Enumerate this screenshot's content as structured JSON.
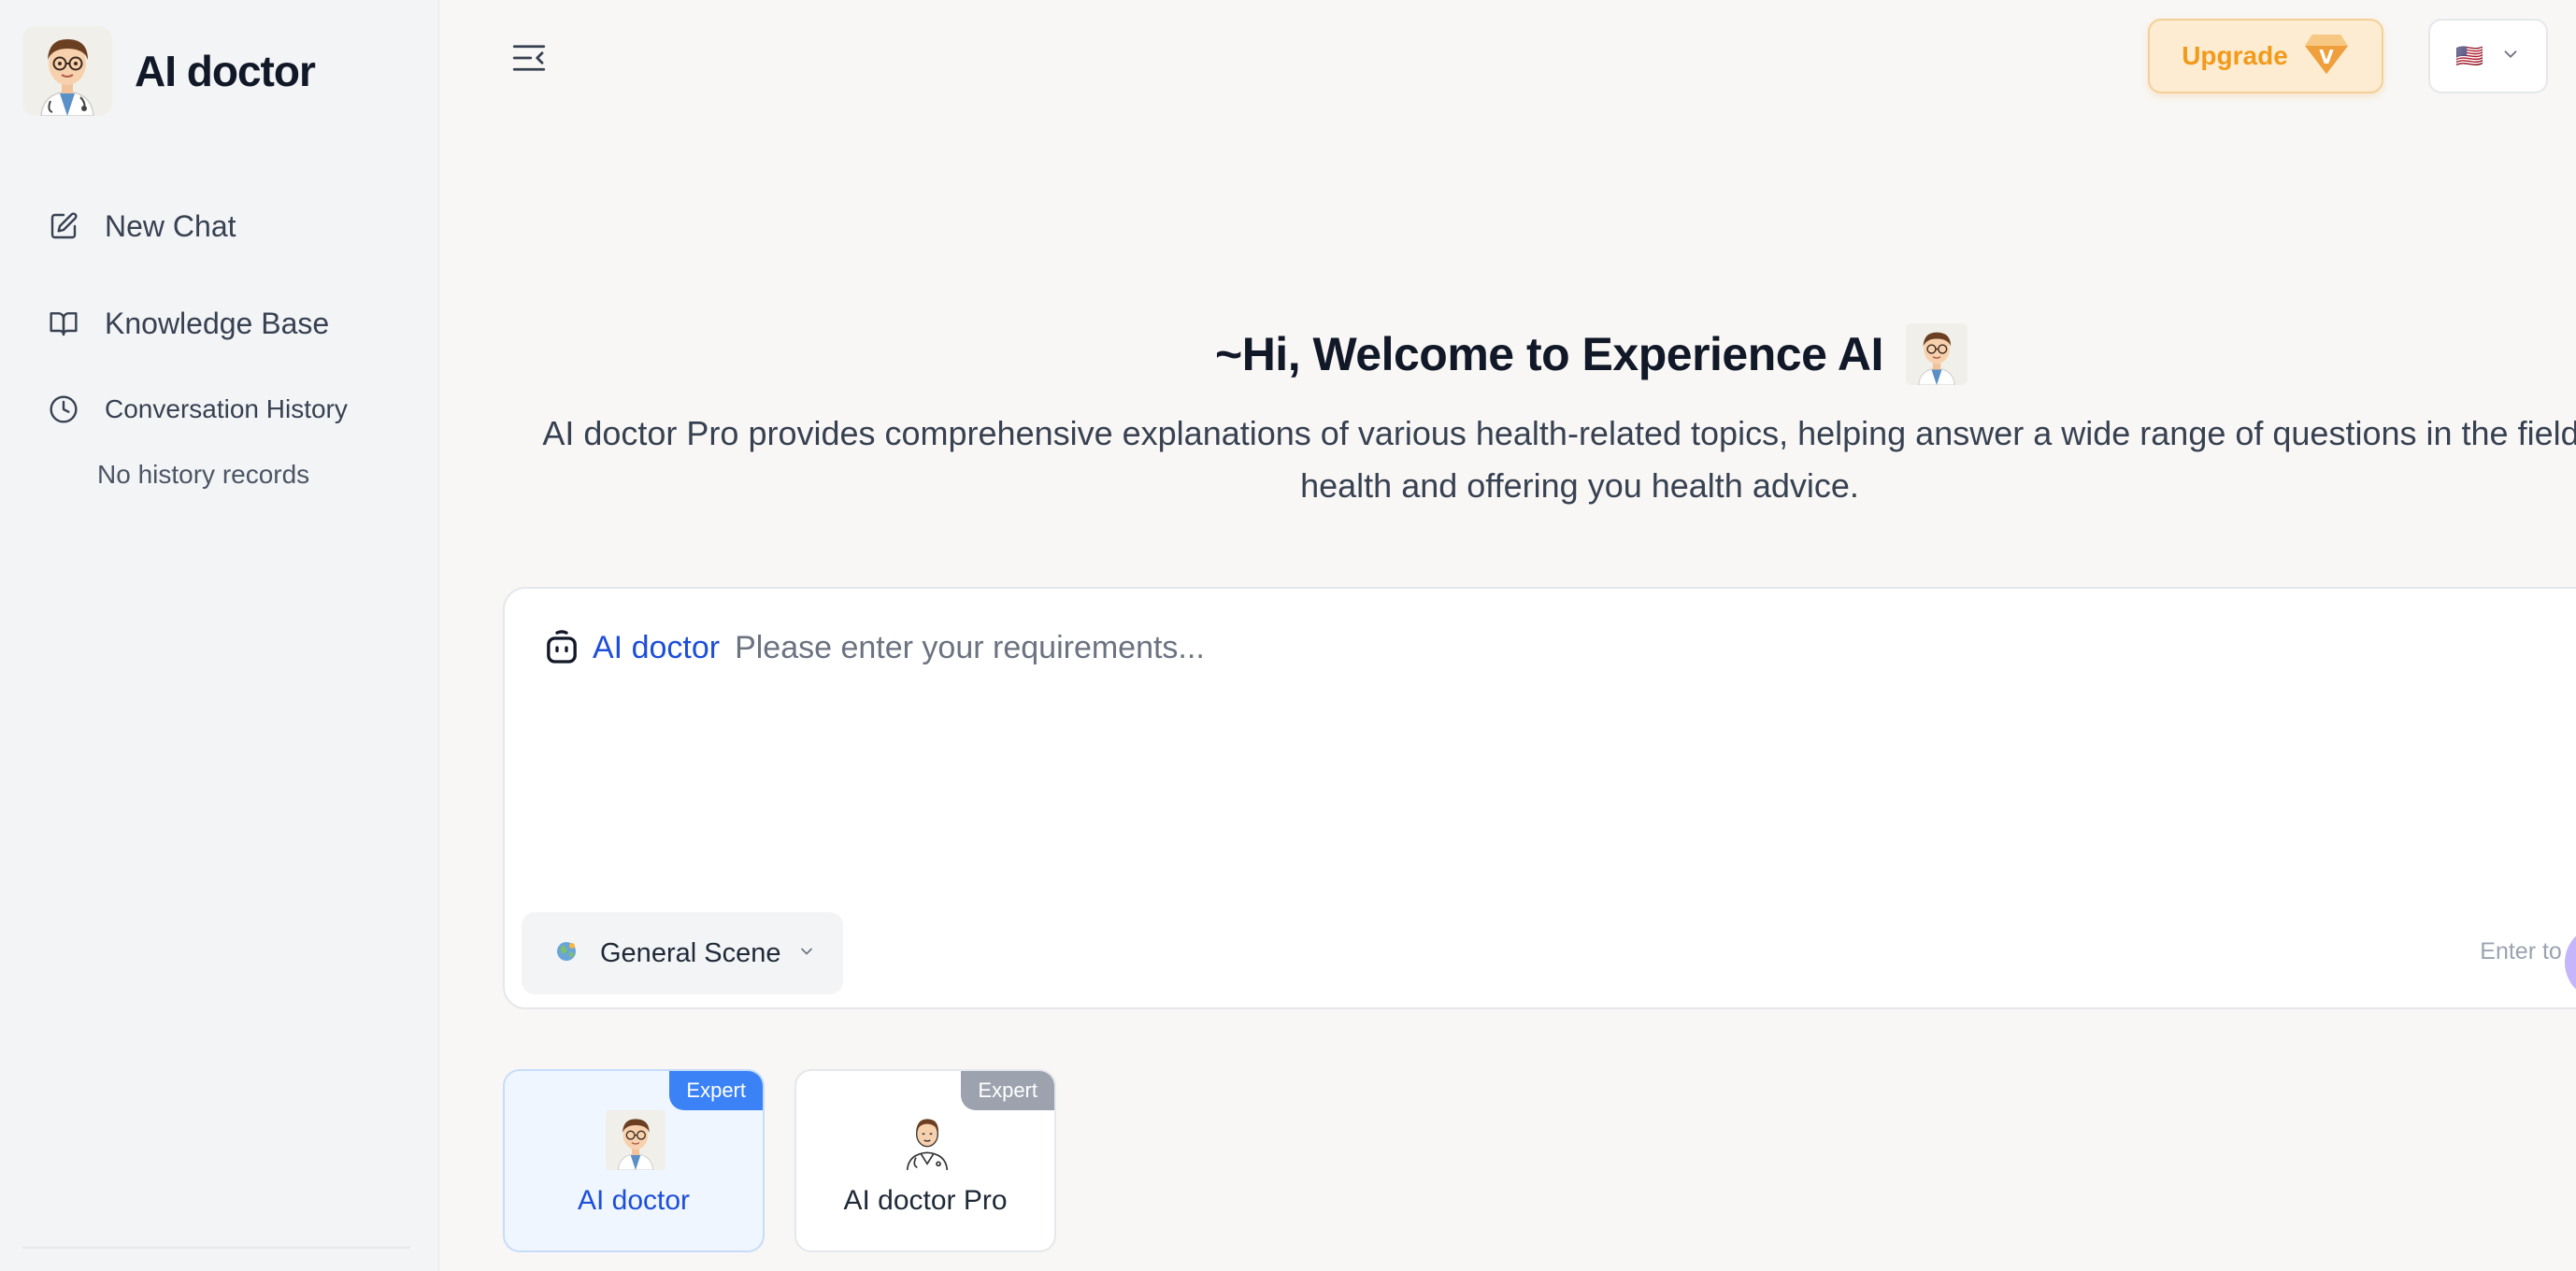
{
  "app": {
    "title": "AI doctor"
  },
  "sidebar": {
    "items": [
      {
        "label": "New Chat",
        "icon": "edit-icon"
      },
      {
        "label": "Knowledge Base",
        "icon": "book-icon"
      },
      {
        "label": "Conversation History",
        "icon": "clock-icon"
      }
    ],
    "history_empty": "No history records"
  },
  "header": {
    "upgrade_label": "Upgrade",
    "upgrade_icon_letter": "V",
    "language_flag": "🇺🇸"
  },
  "welcome": {
    "title": "~Hi, Welcome to Experience AI",
    "subtitle": "AI doctor Pro provides comprehensive explanations of various health-related topics, helping answer a wide range of questions in the field of health and offering you health advice."
  },
  "composer": {
    "agent_name": "AI doctor",
    "placeholder": "Please enter your requirements...",
    "value": "",
    "scene_label": "General Scene",
    "enter_hint": "Enter to send"
  },
  "experts": [
    {
      "name": "AI doctor",
      "badge": "Expert",
      "active": true
    },
    {
      "name": "AI doctor Pro",
      "badge": "Expert",
      "active": false
    }
  ],
  "colors": {
    "accent": "#1d4ed8",
    "badge_active": "#3b82f6",
    "badge_inactive": "#9ca3af",
    "upgrade": "#f29a1a"
  }
}
